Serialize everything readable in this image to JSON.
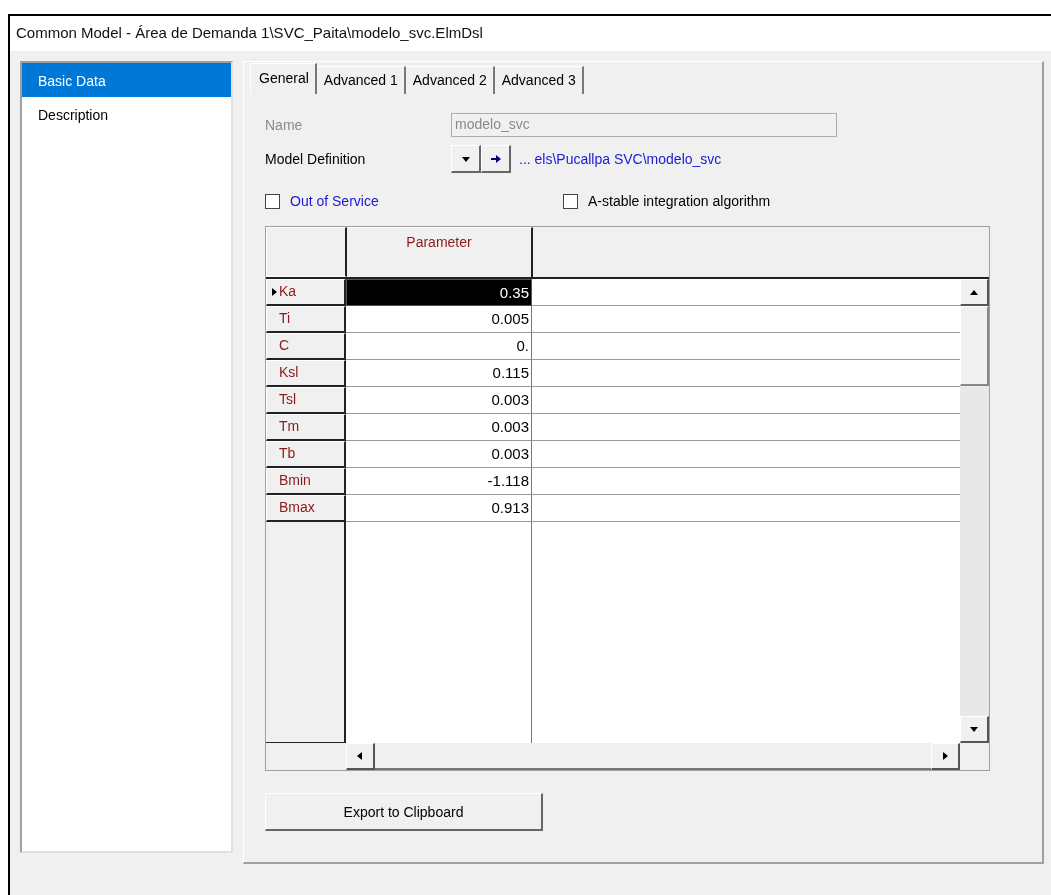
{
  "window": {
    "title": "Common Model - Área de Demanda 1\\SVC_Paita\\modelo_svc.ElmDsl"
  },
  "sidebar": {
    "items": [
      {
        "label": "Basic Data",
        "selected": true
      },
      {
        "label": "Description",
        "selected": false
      }
    ]
  },
  "tabs": [
    {
      "label": "General",
      "selected": true
    },
    {
      "label": "Advanced 1",
      "selected": false
    },
    {
      "label": "Advanced 2",
      "selected": false
    },
    {
      "label": "Advanced 3",
      "selected": false
    }
  ],
  "form": {
    "name": {
      "label": "Name",
      "value": "modelo_svc",
      "disabled": true
    },
    "model_definition": {
      "label": "Model Definition",
      "path": "... els\\Pucallpa SVC\\modelo_svc"
    },
    "checkboxes": [
      {
        "label": "Out of Service",
        "checked": false,
        "kind": "link"
      },
      {
        "label": "A-stable integration algorithm",
        "checked": false,
        "kind": "plain"
      }
    ]
  },
  "table": {
    "columns": [
      "Parameter"
    ],
    "rows": [
      {
        "name": "Ka",
        "value": "0.35",
        "selected": true
      },
      {
        "name": "Ti",
        "value": "0.005",
        "selected": false
      },
      {
        "name": "C",
        "value": "0.",
        "selected": false
      },
      {
        "name": "Ksl",
        "value": "0.115",
        "selected": false
      },
      {
        "name": "Tsl",
        "value": "0.003",
        "selected": false
      },
      {
        "name": "Tm",
        "value": "0.003",
        "selected": false
      },
      {
        "name": "Tb",
        "value": "0.003",
        "selected": false
      },
      {
        "name": "Bmin",
        "value": "-1.118",
        "selected": false
      },
      {
        "name": "Bmax",
        "value": "0.913",
        "selected": false
      }
    ]
  },
  "buttons": [
    "Export to Clipboard"
  ]
}
